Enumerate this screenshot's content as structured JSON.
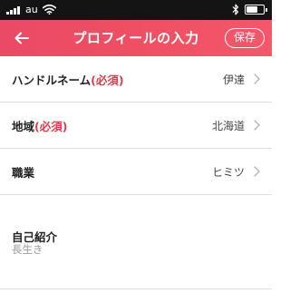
{
  "status_bar": {
    "carrier": "au",
    "icons": [
      "signal-icon",
      "wifi-icon",
      "bluetooth-icon",
      "battery-icon"
    ],
    "battery_level": 0.7
  },
  "header": {
    "title": "プロフィールの入力",
    "save_label": "保存",
    "back_icon": "arrow-left-icon",
    "colors": {
      "bar": "#ef4f63",
      "text": "#ffffff"
    }
  },
  "form": {
    "required_color": "#e23b4e",
    "rows": [
      {
        "label": "ハンドルネーム",
        "required": "(必須)",
        "value": "伊達"
      },
      {
        "label": "地域",
        "required": "(必須)",
        "value": "北海道"
      },
      {
        "label": "職業",
        "value": "ヒミツ"
      }
    ],
    "intro": {
      "label": "自己紹介",
      "value": "長生き"
    }
  }
}
